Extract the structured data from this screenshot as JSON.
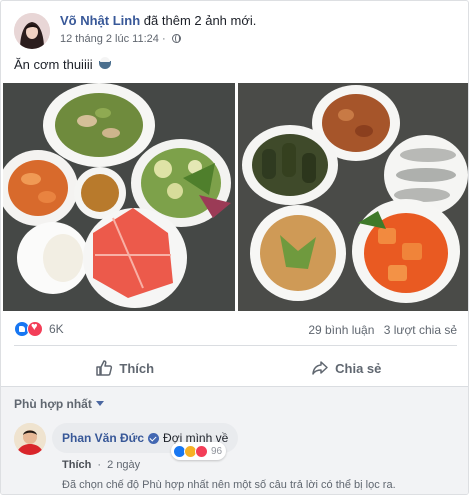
{
  "post": {
    "author": "Võ Nhật Linh",
    "action": "đã thêm 2 ảnh mới.",
    "timestamp": "12 tháng 2 lúc 11:24",
    "privacy_icon": "globe-icon",
    "caption": "Ăn cơm thuiiii",
    "caption_emoji": "rice-bowl-emoji"
  },
  "stats": {
    "reaction_count": "6K",
    "comments": "29 bình luận",
    "shares": "3 lượt chia sẻ"
  },
  "actions": {
    "like_label": "Thích",
    "share_label": "Chia sẻ"
  },
  "comments": {
    "sort_label": "Phù hợp nhất",
    "items": [
      {
        "name": "Phan Văn Đức",
        "text": "Đợi mình về",
        "reaction_count": "96",
        "like_label": "Thích",
        "separator": "·",
        "time": "2 ngày"
      }
    ],
    "filter_notice": "Đã chọn chế độ Phù hợp nhất nên một số câu trả lời có thể bị lọc ra."
  },
  "colors": {
    "link": "#385898",
    "like_blue": "#1877f2",
    "love_red": "#f33e58",
    "comment_bg": "#f2f3f5"
  }
}
